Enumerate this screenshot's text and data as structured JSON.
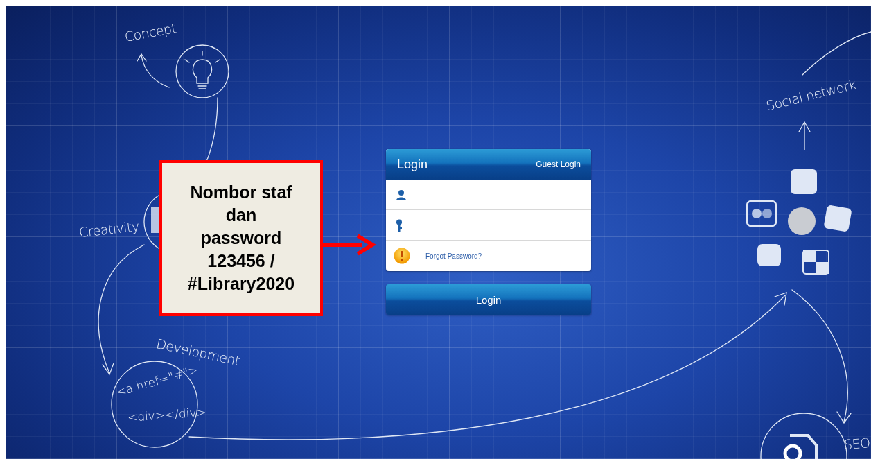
{
  "background_labels": [
    {
      "text": "Concept",
      "kind": "plain"
    },
    {
      "text": "Creativity",
      "kind": "plain"
    },
    {
      "text": "Development",
      "kind": "plain"
    },
    {
      "text": "<a href=\"#\">",
      "kind": "code"
    },
    {
      "text": "<div></div>",
      "kind": "code"
    },
    {
      "text": "Social network",
      "kind": "plain"
    },
    {
      "text": "SEO",
      "kind": "plain"
    }
  ],
  "login": {
    "title": "Login",
    "guest_link": "Guest Login",
    "fields": [
      {
        "kind": "username"
      },
      {
        "kind": "password"
      }
    ],
    "forgot_link": "Forgot Password?",
    "button": "Login"
  },
  "annotation": {
    "text": "Nombor staf dan password 123456 / #Library2020"
  }
}
